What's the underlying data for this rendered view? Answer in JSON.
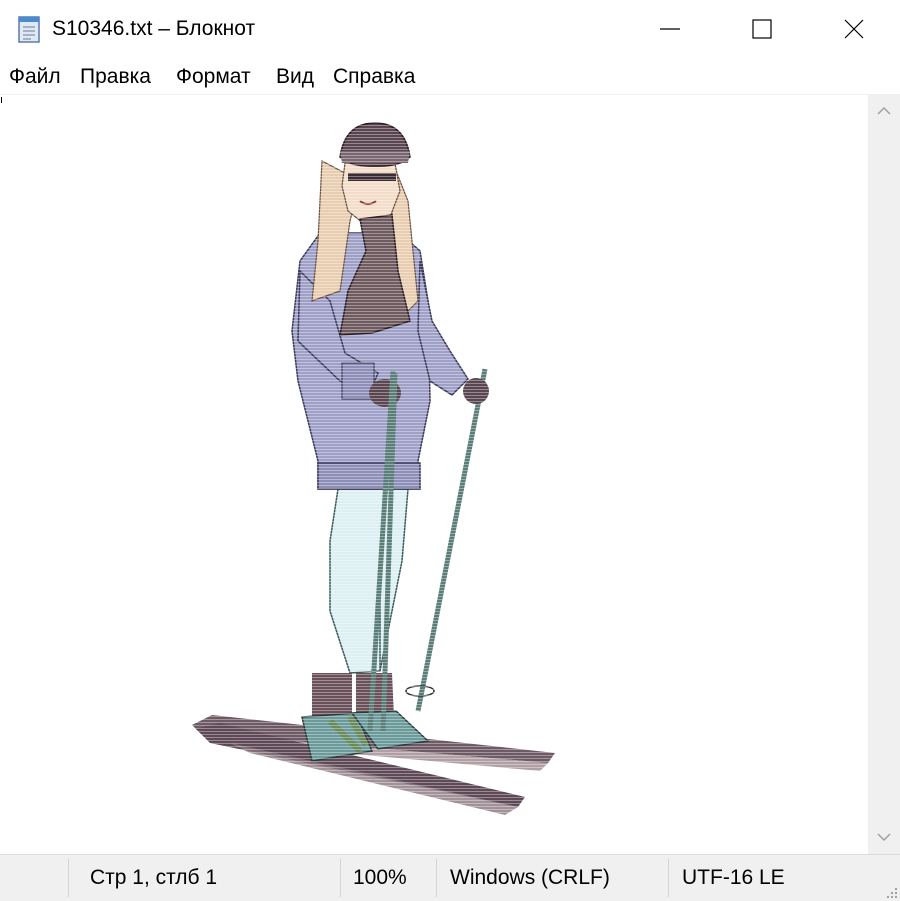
{
  "window": {
    "title": "S10346.txt – Блокнот",
    "icon": "notepad-icon",
    "controls": [
      "minimize-icon",
      "maximize-icon",
      "close-icon"
    ]
  },
  "menu": {
    "items": [
      {
        "label": "Файл"
      },
      {
        "label": "Правка"
      },
      {
        "label": "Формат"
      },
      {
        "label": "Вид"
      },
      {
        "label": "Справка"
      }
    ]
  },
  "editor": {
    "content_image": "skier-woman-ascii-art",
    "colors": {
      "hat": "#5a4650",
      "hair": "#e8cdb0",
      "sweater": "#9fa0c8",
      "scarf": "#6f5a60",
      "tights": "#dceff2",
      "boots": "#6a9a9a",
      "skis": "#6e5a64",
      "pole": "#5a7d78"
    }
  },
  "status": {
    "position": "Стр 1, стлб 1",
    "zoom": "100%",
    "line_endings": "Windows (CRLF)",
    "encoding": "UTF-16 LE"
  }
}
